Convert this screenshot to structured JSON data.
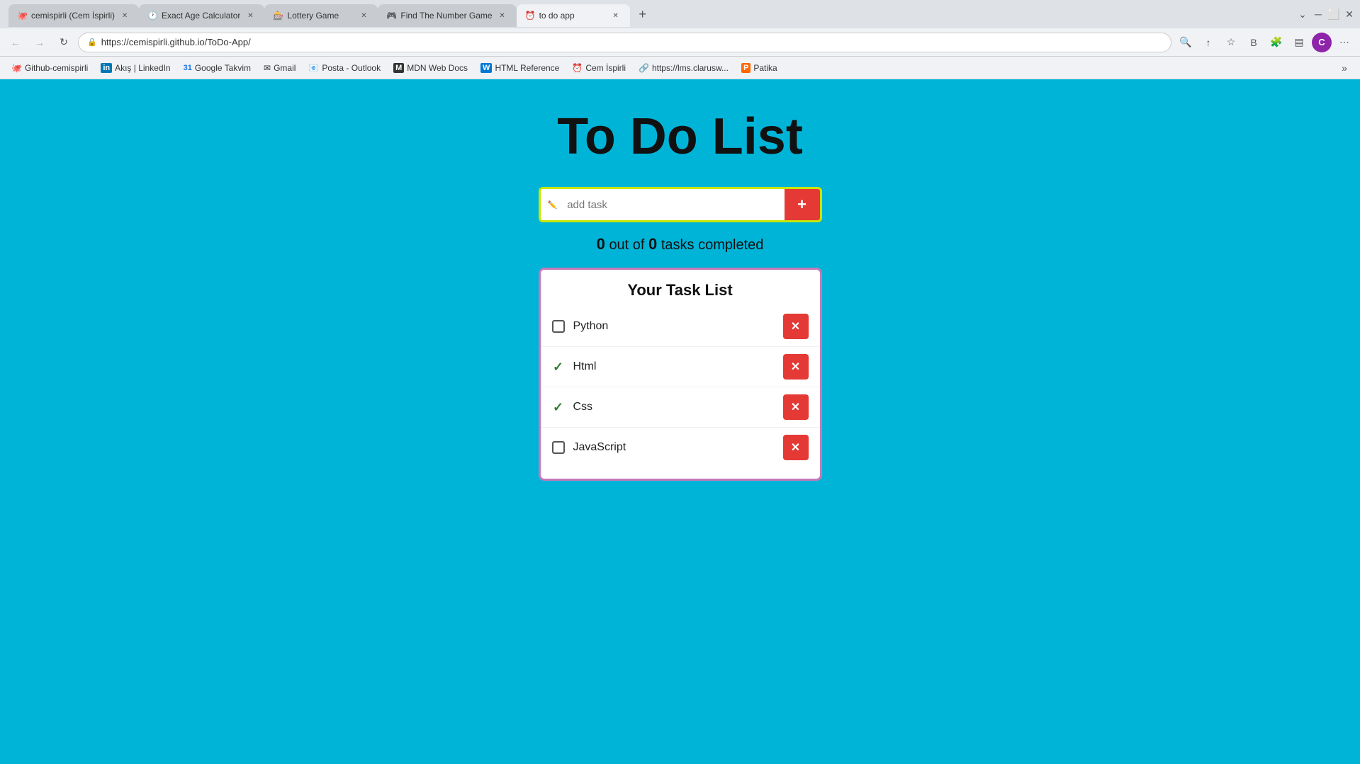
{
  "browser": {
    "tabs": [
      {
        "id": 1,
        "title": "cemispirli (Cem İspirli)",
        "favicon": "🐙",
        "active": false
      },
      {
        "id": 2,
        "title": "Exact Age Calculator",
        "favicon": "🕐",
        "active": false
      },
      {
        "id": 3,
        "title": "Lottery Game",
        "favicon": "🎰",
        "active": false
      },
      {
        "id": 4,
        "title": "Find The Number Game",
        "favicon": "🎮",
        "active": false
      },
      {
        "id": 5,
        "title": "to do app",
        "favicon": "⏰",
        "active": true
      }
    ],
    "address": "https://cemispirli.github.io/ToDo-App/",
    "bookmarks": [
      {
        "label": "Github-cemispirli",
        "favicon": "🐙"
      },
      {
        "label": "Akış | LinkedIn",
        "favicon": "in"
      },
      {
        "label": "Google Takvim",
        "favicon": "📅"
      },
      {
        "label": "Gmail",
        "favicon": "✉"
      },
      {
        "label": "Posta - Outlook",
        "favicon": "📧"
      },
      {
        "label": "MDN Web Docs",
        "favicon": "M"
      },
      {
        "label": "HTML Reference",
        "favicon": "W"
      },
      {
        "label": "Cem İspirli",
        "favicon": "C"
      },
      {
        "label": "https://lms.clarusw...",
        "favicon": "🔗"
      },
      {
        "label": "Patika",
        "favicon": "⬡"
      }
    ]
  },
  "app": {
    "title": "To Do List",
    "input_placeholder": "add task",
    "add_button_label": "+",
    "task_count_completed": "0",
    "task_count_total": "0",
    "task_count_text_before": "out of",
    "task_count_text_after": "tasks completed",
    "task_list_title": "Your Task List",
    "tasks": [
      {
        "id": 1,
        "label": "Python",
        "completed": false
      },
      {
        "id": 2,
        "label": "Html",
        "completed": true
      },
      {
        "id": 3,
        "label": "Css",
        "completed": true
      },
      {
        "id": 4,
        "label": "JavaScript",
        "completed": false
      }
    ]
  },
  "colors": {
    "bg": "#00b4d8",
    "input_border": "#c8e600",
    "list_border": "#c678b8",
    "delete_btn": "#e53935",
    "checkmark": "#2e7d32",
    "add_btn": "#e53935"
  }
}
